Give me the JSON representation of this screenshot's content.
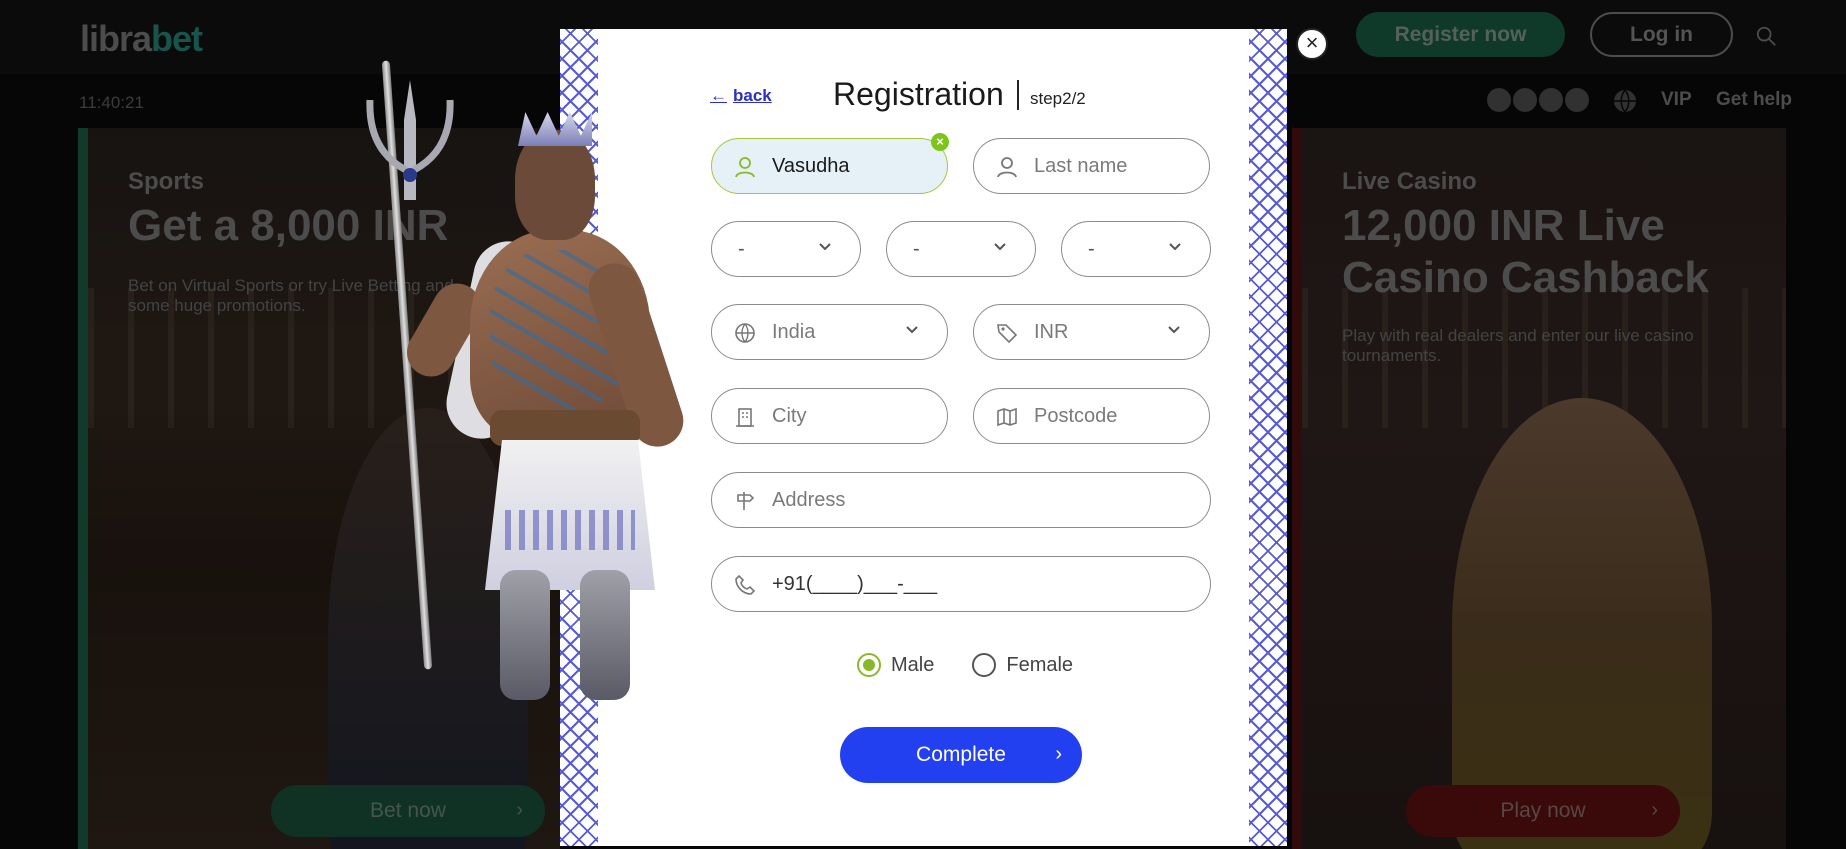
{
  "header": {
    "logo_main": "libra",
    "logo_accent": "bet",
    "register_label": "Register now",
    "login_label": "Log in",
    "search_icon": "search-icon"
  },
  "subbar": {
    "clock": "11:40:21",
    "crypto_icons": [
      "litecoin-icon",
      "ethereum-icon",
      "ripple-icon",
      "bitcoin-icon"
    ],
    "nav": {
      "vip": "VIP",
      "help": "Get help"
    }
  },
  "promos": {
    "sports": {
      "tag": "Sports",
      "title": "Get a 8,000 INR",
      "desc_line1": "Bet on Virtual Sports or try Live Betting and",
      "desc_line2": "some huge promotions.",
      "button": "Bet now"
    },
    "casino": {
      "tag": "Live Casino",
      "title_line1": "12,000 INR Live",
      "title_line2": "Casino Cashback",
      "desc_line1": "Play with real dealers and enter our live casino",
      "desc_line2": "tournaments.",
      "button": "Play now"
    }
  },
  "modal": {
    "back_label": "back",
    "title": "Registration",
    "step": "step2/2",
    "first_name": {
      "value": "Vasudha"
    },
    "last_name": {
      "placeholder": "Last name"
    },
    "dob": {
      "day": "-",
      "month": "-",
      "year": "-"
    },
    "country": "India",
    "currency": "INR",
    "city": {
      "placeholder": "City"
    },
    "postcode": {
      "placeholder": "Postcode"
    },
    "address": {
      "placeholder": "Address"
    },
    "phone": {
      "mask": "+91(____)___-___"
    },
    "gender": {
      "options": [
        "Male",
        "Female"
      ],
      "selected": "Male"
    },
    "complete_label": "Complete",
    "colors": {
      "accent": "#2340f0",
      "valid": "#8ab82a",
      "border_pattern": "#3a3fd0"
    }
  }
}
